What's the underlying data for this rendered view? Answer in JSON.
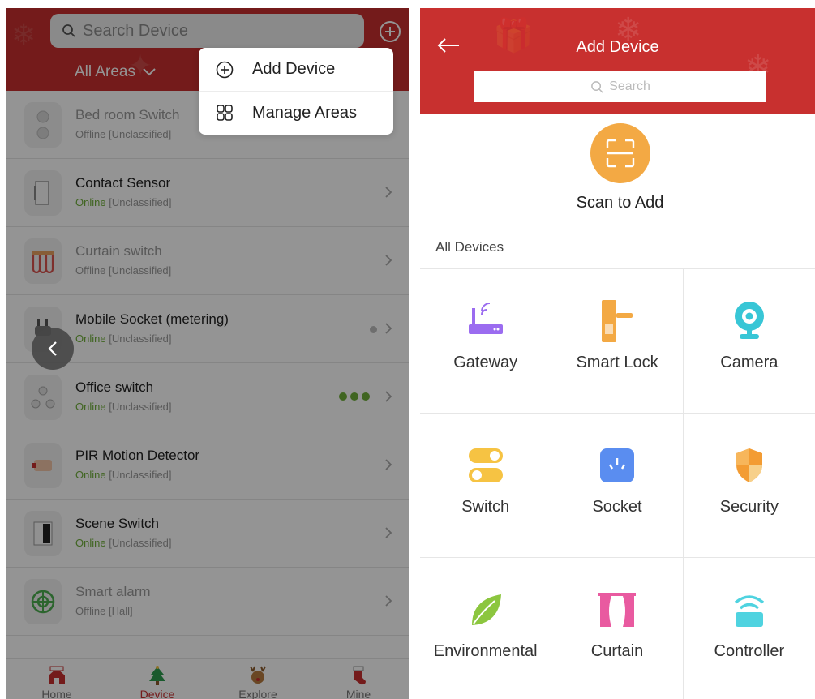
{
  "left": {
    "search": {
      "placeholder": "Search Device"
    },
    "areas_label": "All Areas",
    "popup": {
      "add_device": "Add Device",
      "manage_areas": "Manage Areas"
    },
    "devices": [
      {
        "name": "Bed room Switch",
        "state": "Offline",
        "area": "[Unclassified]"
      },
      {
        "name": "Contact Sensor",
        "state": "Online",
        "area": "[Unclassified]"
      },
      {
        "name": "Curtain switch",
        "state": "Offline",
        "area": "[Unclassified]"
      },
      {
        "name": "Mobile Socket (metering)",
        "state": "Online",
        "area": "[Unclassified]"
      },
      {
        "name": "Office switch",
        "state": "Online",
        "area": "[Unclassified]"
      },
      {
        "name": "PIR Motion Detector",
        "state": "Online",
        "area": "[Unclassified]"
      },
      {
        "name": "Scene Switch",
        "state": "Online",
        "area": "[Unclassified]"
      },
      {
        "name": "Smart alarm",
        "state": "Offline",
        "area": "[Hall]"
      }
    ],
    "tabs": [
      "Home",
      "Device",
      "Explore",
      "Mine"
    ]
  },
  "right": {
    "title": "Add Device",
    "search": {
      "placeholder": "Search"
    },
    "scan_label": "Scan to Add",
    "section_label": "All Devices",
    "categories": [
      {
        "label": "Gateway",
        "icon": "router-icon"
      },
      {
        "label": "Smart Lock",
        "icon": "door-lock-icon"
      },
      {
        "label": "Camera",
        "icon": "webcam-icon"
      },
      {
        "label": "Switch",
        "icon": "toggle-switch-icon"
      },
      {
        "label": "Socket",
        "icon": "power-socket-icon"
      },
      {
        "label": "Security",
        "icon": "shield-icon"
      },
      {
        "label": "Environmental",
        "icon": "leaf-icon"
      },
      {
        "label": "Curtain",
        "icon": "curtain-icon"
      },
      {
        "label": "Controller",
        "icon": "wifi-signal-icon"
      }
    ]
  },
  "colors": {
    "header_red": "#c8302f",
    "online_green": "#6fae3a",
    "scan_orange": "#f3a944",
    "gateway_purple": "#9b6cf0",
    "lock_orange": "#f3a944",
    "camera_teal": "#38c6d6",
    "switch_yellow": "#f6c343",
    "socket_blue": "#5a8df0",
    "security_orange": "#f39c33",
    "leaf_green": "#8cc63f",
    "curtain_pink": "#e95aa0",
    "controller_cyan": "#4fd3e0"
  }
}
